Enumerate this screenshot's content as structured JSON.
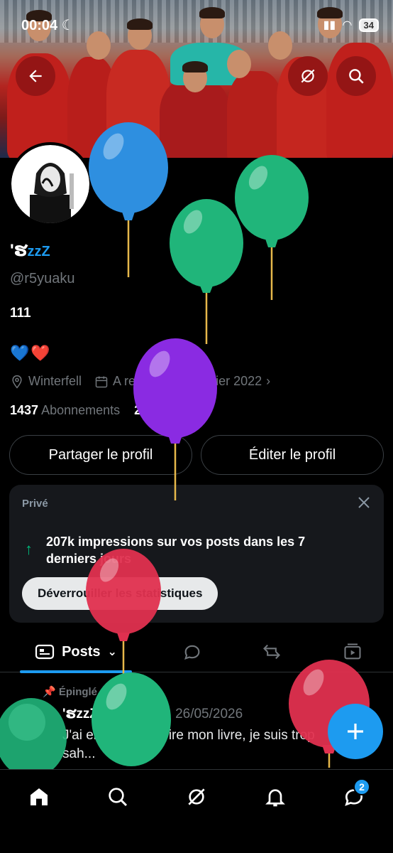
{
  "status_bar": {
    "time": "00:04",
    "battery": "34"
  },
  "profile": {
    "name": "'ຮ",
    "name_suffix": "zzZ",
    "handle": "@r5yuaku",
    "bio": "111",
    "emoji": "💙❤️",
    "location": "Winterfell",
    "joined": "A rejoint X en janvier 2022",
    "following_count": "1437",
    "following_label": "Abonnements",
    "followers_count": "299",
    "followers_label": "Abonnés"
  },
  "actions": {
    "share": "Partager le profil",
    "edit": "Éditer le profil"
  },
  "insights_card": {
    "tag": "Privé",
    "text": "207k impressions sur vos posts dans les 7 derniers jours",
    "button": "Déverrouiller les statistiques"
  },
  "tabs": {
    "posts": "Posts"
  },
  "post": {
    "pinned_label": "Épinglé",
    "author": "'ຮzzZ",
    "handle": "@r5yuaku",
    "date": "· 26/05/2026",
    "text": "J'ai enfin fini d'écrire mon livre, je suis trop sah..."
  },
  "nav": {
    "messages_badge": "2"
  },
  "colors": {
    "accent": "#1d9bf0",
    "background": "#000000",
    "card": "#16181c"
  }
}
